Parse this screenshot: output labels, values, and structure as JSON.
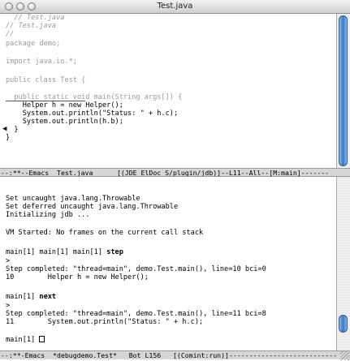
{
  "window": {
    "title": "Test.java"
  },
  "editor": {
    "lines": [
      "  // Test.java",
      "// Test.java",
      "//",
      "package demo;",
      "",
      "import java.io.*;",
      "",
      "public class Test {",
      "",
      "  public static void main(String args[]) {",
      "    Helper h = new Helper();",
      "    System.out.println(\"Status: \" + h.c);",
      "    System.out.println(h.b);",
      "  }",
      "}"
    ],
    "breakpoint_marker": "◀"
  },
  "modeline_top": "--:**--Emacs  Test.java      [(JDE ElDoc S/plugin/jdb)]--L11--All--[M:main]-------",
  "debug": {
    "lines": [
      "Set uncaught java.lang.Throwable",
      "Set deferred uncaught java.lang.Throwable",
      "Initializing jdb ...",
      "",
      "VM Started: No frames on the current call stack",
      "",
      "main[1] main[1] main[1] ",
      ">",
      "Step completed: \"thread=main\", demo.Test.main(), line=10 bci=0",
      "10        Helper h = new Helper();",
      "",
      "main[1] ",
      ">",
      "Step completed: \"thread=main\", demo.Test.main(), line=11 bci=8",
      "11        System.out.println(\"Status: \" + h.c);",
      "",
      "main[1] "
    ],
    "cmd_step": "step",
    "cmd_next": "next"
  },
  "modeline_bottom": "--:**-Emacs  *debugdemo.Test*   Bot L156   [(Comint:run)]---------------------------"
}
